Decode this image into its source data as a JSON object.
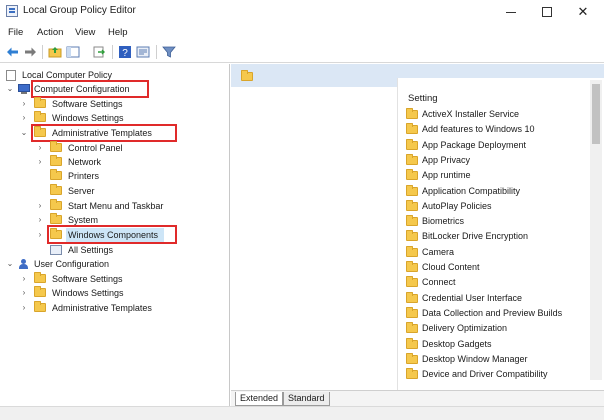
{
  "window": {
    "title": "Local Group Policy Editor",
    "minimize_glyph": "",
    "close_glyph": "✕"
  },
  "menu": [
    "File",
    "Action",
    "View",
    "Help"
  ],
  "toolbar": {
    "icons": [
      "back-icon",
      "forward-icon",
      "up-folder-icon",
      "show-hide-tree-icon",
      "export-list-icon",
      "help-icon",
      "properties-icon",
      "filter-icon"
    ]
  },
  "tree": {
    "root": "Local Computer Policy",
    "computer_configuration": "Computer Configuration",
    "software_settings": "Software Settings",
    "windows_settings": "Windows Settings",
    "administrative_templates": "Administrative Templates",
    "control_panel": "Control Panel",
    "network": "Network",
    "printers": "Printers",
    "server": "Server",
    "start_menu": "Start Menu and Taskbar",
    "system": "System",
    "windows_components": "Windows Components",
    "all_settings": "All Settings",
    "user_configuration": "User Configuration",
    "user_software_settings": "Software Settings",
    "user_windows_settings": "Windows Settings",
    "user_administrative_templates": "Administrative Templates"
  },
  "highlight_color": "#e02a2a",
  "list": {
    "column_header": "Setting",
    "items": [
      "ActiveX Installer Service",
      "Add features to Windows 10",
      "App Package Deployment",
      "App Privacy",
      "App runtime",
      "Application Compatibility",
      "AutoPlay Policies",
      "Biometrics",
      "BitLocker Drive Encryption",
      "Camera",
      "Cloud Content",
      "Connect",
      "Credential User Interface",
      "Data Collection and Preview Builds",
      "Delivery Optimization",
      "Desktop Gadgets",
      "Desktop Window Manager",
      "Device and Driver Compatibility"
    ]
  },
  "tabs": [
    "Extended",
    "Standard"
  ]
}
